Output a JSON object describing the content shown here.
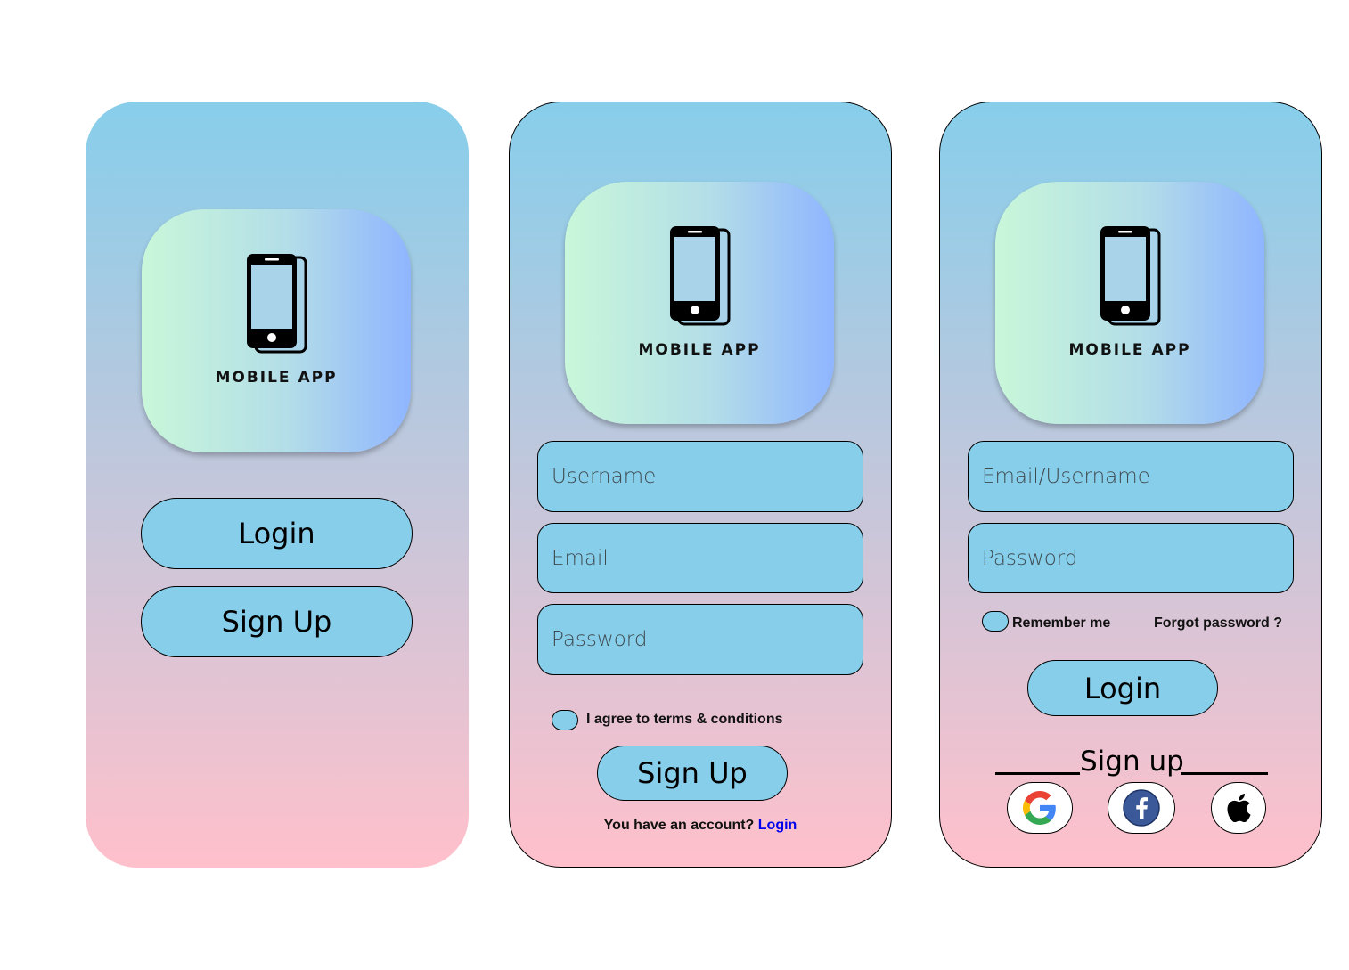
{
  "brand": {
    "name": "MOBILE APP",
    "icon": "smartphone-icon"
  },
  "colors": {
    "gradient_top": "#87ceeb",
    "gradient_bottom": "#ffc0cb",
    "field_bg": "#87ceeb",
    "link": "#0000ee"
  },
  "welcome": {
    "login_label": "Login",
    "signup_label": "Sign Up"
  },
  "signup": {
    "username_placeholder": "Username",
    "email_placeholder": "Email",
    "password_placeholder": "Password",
    "terms_label": "I agree to terms & conditions",
    "submit_label": "Sign Up",
    "account_prompt": "You have an account?",
    "login_link": "Login"
  },
  "login": {
    "email_placeholder": "Email/Username",
    "password_placeholder": "Password",
    "remember_label": "Remember me",
    "forgot_label": "Forgot password ?",
    "submit_label": "Login",
    "signup_divider_label": "Sign up",
    "social": [
      {
        "icon": "google-icon"
      },
      {
        "icon": "facebook-icon"
      },
      {
        "icon": "apple-icon"
      }
    ]
  }
}
